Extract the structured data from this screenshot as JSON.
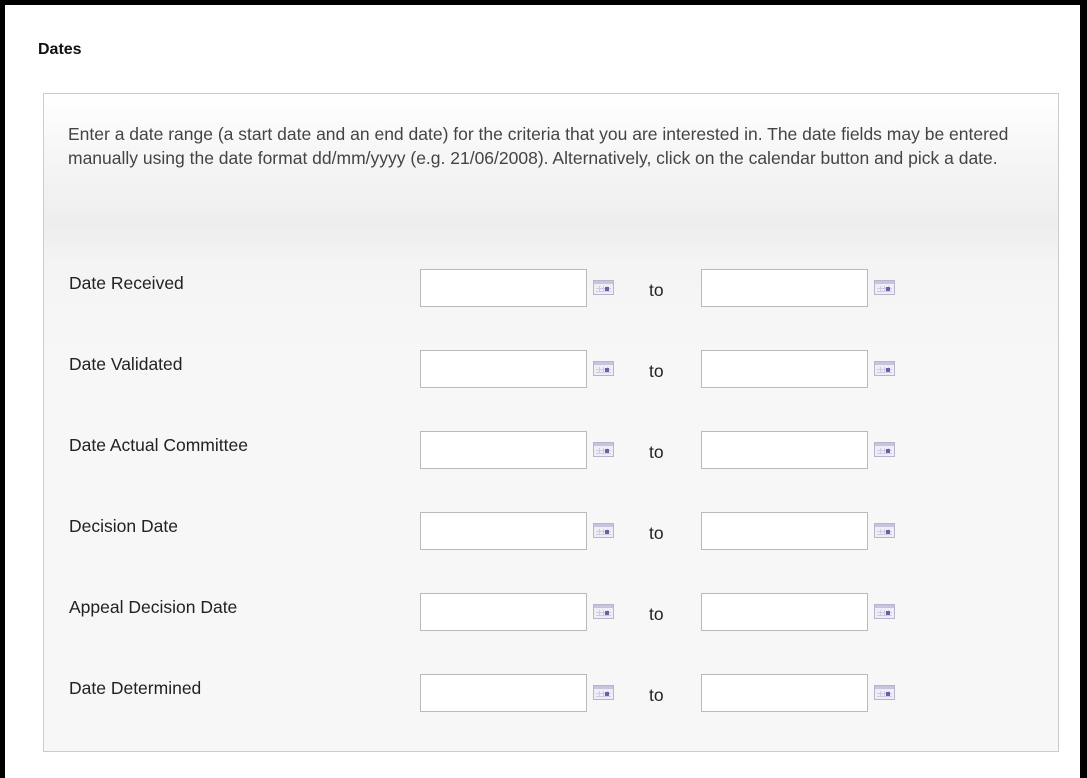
{
  "section": {
    "title": "Dates"
  },
  "intro": {
    "text": "Enter a date range (a start date and an end date) for the criteria that you are interested in. The date fields may be entered manually using the date format dd/mm/yyyy (e.g. 21/06/2008). Alternatively, click on the calendar button and pick a date."
  },
  "range_separator": "to",
  "icons": {
    "calendar": "calendar-icon"
  },
  "rows": [
    {
      "label": "Date Received",
      "from_value": "",
      "to_value": ""
    },
    {
      "label": "Date Validated",
      "from_value": "",
      "to_value": ""
    },
    {
      "label": "Date Actual Committee",
      "from_value": "",
      "to_value": ""
    },
    {
      "label": "Decision Date",
      "from_value": "",
      "to_value": ""
    },
    {
      "label": "Appeal Decision Date",
      "from_value": "",
      "to_value": ""
    },
    {
      "label": "Date Determined",
      "from_value": "",
      "to_value": ""
    }
  ],
  "colors": {
    "panel_border": "#cccccc",
    "calendar_accent": "#6a5fa8"
  }
}
